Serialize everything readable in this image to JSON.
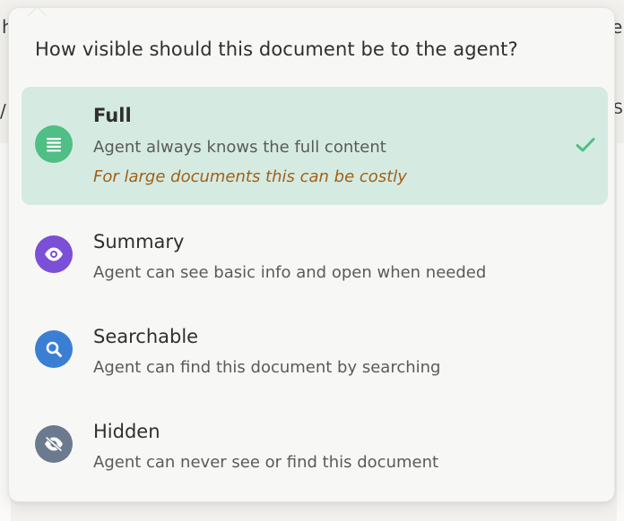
{
  "popover": {
    "title": "How visible should this document be to the agent?",
    "options": [
      {
        "title": "Full",
        "description": "Agent always knows the full content",
        "note": "For large documents this can be costly",
        "icon": "document-lines-icon",
        "icon_color": "#4fbf85",
        "selected": true
      },
      {
        "title": "Summary",
        "description": "Agent can see basic info and open when needed",
        "icon": "eye-icon",
        "icon_color": "#7b4fd6",
        "selected": false
      },
      {
        "title": "Searchable",
        "description": "Agent can find this document by searching",
        "icon": "search-icon",
        "icon_color": "#3b7fd4",
        "selected": false
      },
      {
        "title": "Hidden",
        "description": "Agent can never see or find this document",
        "icon": "eye-slash-icon",
        "icon_color": "#6b7a8f",
        "selected": false
      }
    ],
    "selected_check_color": "#4fbf85",
    "selected_bg_color": "#d5ebe1",
    "note_color": "#a0601a"
  },
  "background": {
    "fragment_left_top": "h",
    "fragment_right_top": "e",
    "fragment_left_mid": "/",
    "fragment_right_mid": "S"
  }
}
